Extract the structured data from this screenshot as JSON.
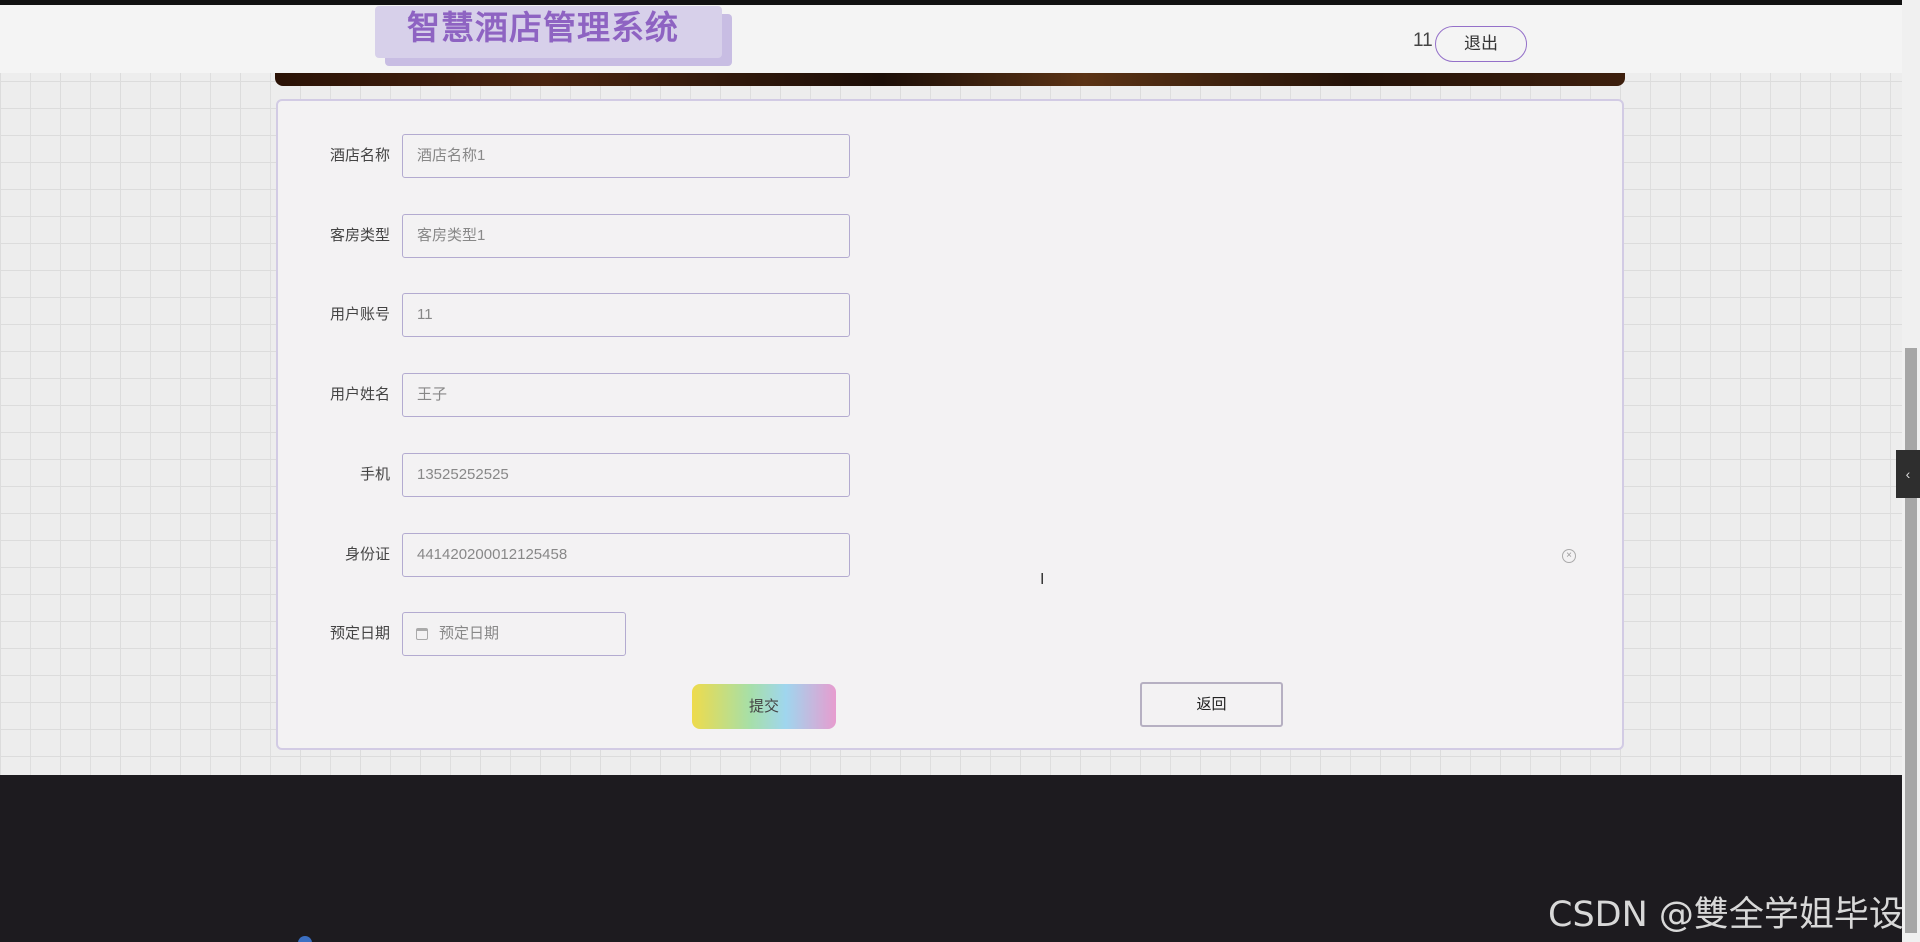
{
  "header": {
    "brand_title": "智慧酒店管理系统",
    "username": "11",
    "logout_label": "退出"
  },
  "form": {
    "fields": [
      {
        "label": "酒店名称",
        "value": "酒店名称1"
      },
      {
        "label": "客房类型",
        "value": "客房类型1"
      },
      {
        "label": "用户账号",
        "value": "11"
      },
      {
        "label": "用户姓名",
        "value": "王子"
      },
      {
        "label": "手机",
        "value": "13525252525"
      },
      {
        "label": "身份证",
        "value": "441420200012125458"
      }
    ],
    "date_field": {
      "label": "预定日期",
      "placeholder": "预定日期"
    },
    "submit_label": "提交",
    "back_label": "返回"
  },
  "watermark": "CSDN @雙全学姐毕设",
  "colors": {
    "accent": "#8e63c2",
    "border": "#b3abd0",
    "footer": "#1d1b1f"
  }
}
